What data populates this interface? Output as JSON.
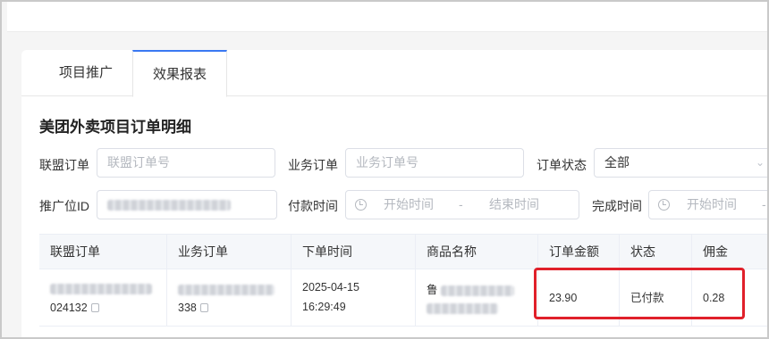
{
  "tabs": [
    {
      "label": "项目推广"
    },
    {
      "label": "效果报表"
    }
  ],
  "section_title": "美团外卖项目订单明细",
  "filters": {
    "union_order": {
      "label": "联盟订单",
      "placeholder": "联盟订单号"
    },
    "business_order": {
      "label": "业务订单",
      "placeholder": "业务订单号"
    },
    "order_status": {
      "label": "订单状态",
      "value": "全部"
    },
    "promo_id": {
      "label": "推广位ID"
    },
    "pay_time": {
      "label": "付款时间",
      "start": "开始时间",
      "sep": "-",
      "end": "结束时间"
    },
    "complete_time": {
      "label": "完成时间",
      "start": "开始时间",
      "sep": "-"
    }
  },
  "table": {
    "headers": [
      "联盟订单",
      "业务订单",
      "下单时间",
      "商品名称",
      "订单金额",
      "状态",
      "佣金"
    ],
    "rows": [
      {
        "union_order_tail": "024132",
        "business_order_tail": "338",
        "order_date": "2025-04-15",
        "order_time": "16:29:49",
        "product_prefix": "鲁",
        "amount": "23.90",
        "status": "已付款",
        "commission": "0.28"
      }
    ]
  },
  "colors": {
    "accent": "#3a78f2",
    "highlight": "#e0202a"
  }
}
